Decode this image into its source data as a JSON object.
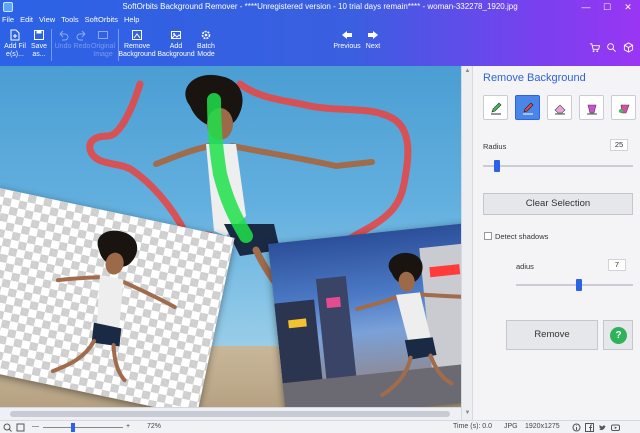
{
  "window": {
    "title": "SoftOrbits Background Remover - ****Unregistered version - 10 trial days remain**** - woman-332278_1920.jpg",
    "minimize": "—",
    "maximize": "☐",
    "close": "✕"
  },
  "menu": [
    "File",
    "Edit",
    "View",
    "Tools",
    "SoftOrbits",
    "Help"
  ],
  "toolbar": {
    "add_files": "Add File(s)...",
    "save_as": "Save as...",
    "undo": "Undo",
    "redo": "Redo",
    "original_image": "Original Image",
    "remove_background": "Remove Background",
    "add_background": "Add Background",
    "batch_mode": "Batch Mode",
    "previous": "Previous",
    "next": "Next"
  },
  "panel": {
    "title": "Remove Background",
    "radius_label": "Radius",
    "radius_value": "25",
    "clear_selection": "Clear Selection",
    "detect_shadows": "Detect shadows",
    "shadow_radius_label": "adius",
    "shadow_radius_value": "7",
    "remove": "Remove",
    "help": "?"
  },
  "status": {
    "zoom": "72%",
    "time": "Time (s): 0.0",
    "format": "JPG",
    "dimensions": "1920x1275"
  },
  "colors": {
    "accent": "#2c62e6",
    "gradient_end": "#9a36f3",
    "stroke_red": "#e24a4a",
    "stroke_green": "#1ee04a"
  }
}
